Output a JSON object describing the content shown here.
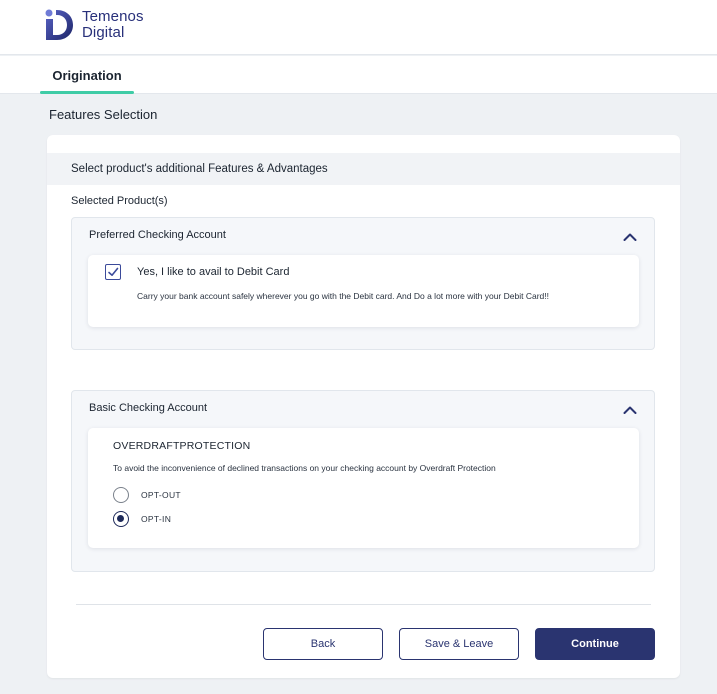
{
  "brand": {
    "line1": "Temenos",
    "line2": "Digital",
    "color": "#28307a"
  },
  "tabs": [
    {
      "label": "Origination",
      "active": true
    }
  ],
  "page": {
    "title": "Features Selection",
    "header": "Select product's additional Features & Advantages",
    "selected_label": "Selected Product(s)"
  },
  "products": [
    {
      "name": "Preferred Checking Account",
      "expanded": true,
      "feature": {
        "title": "Yes, I like to avail to Debit Card",
        "description": "Carry your bank account safely wherever you go with the Debit card. And Do a lot more with your Debit Card!!",
        "checked": true
      }
    },
    {
      "name": "Basic Checking Account",
      "expanded": true,
      "feature": {
        "title": "OVERDRAFTPROTECTION",
        "description": "To avoid the inconvenience of declined transactions on your checking account by Overdraft Protection",
        "options": [
          {
            "label": "OPT-OUT",
            "selected": false
          },
          {
            "label": "OPT-IN",
            "selected": true
          }
        ]
      }
    }
  ],
  "actions": {
    "back": "Back",
    "save_leave": "Save & Leave",
    "continue": "Continue"
  },
  "colors": {
    "accent": "#3fcca6",
    "primary": "#2a3470",
    "background": "#eef1f4"
  }
}
